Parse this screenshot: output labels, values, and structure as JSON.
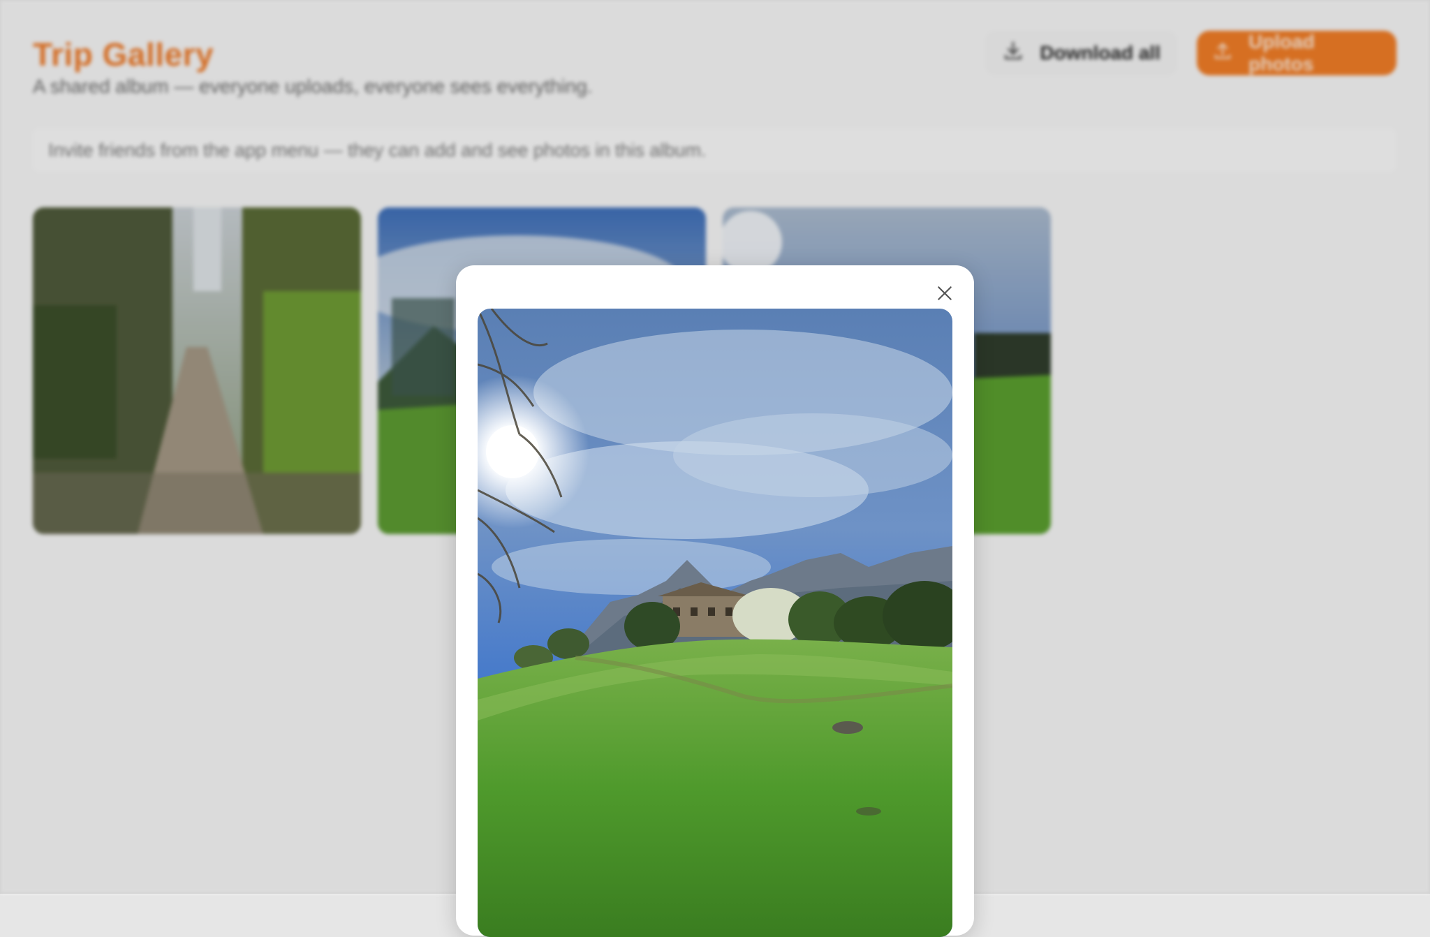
{
  "header": {
    "title": "Trip Gallery",
    "subtitle": "A shared album — everyone uploads, everyone sees everything."
  },
  "actions": {
    "download_label": "Download all",
    "upload_label": "Upload photos"
  },
  "invite_banner": {
    "text": "Invite friends from the app menu — they can add and see photos in this album."
  },
  "gallery": {
    "thumbnails": [
      {
        "name": "photo-forest-path"
      },
      {
        "name": "photo-meadow-sky"
      },
      {
        "name": "photo-hillside-sun"
      }
    ]
  },
  "modal": {
    "close_icon": "close-icon",
    "image": "hillside-meadow-photo"
  },
  "colors": {
    "accent": "#ef7c26",
    "title": "#ec7a2a",
    "sky": "#3f75c8",
    "grass": "#4f9a2c"
  }
}
